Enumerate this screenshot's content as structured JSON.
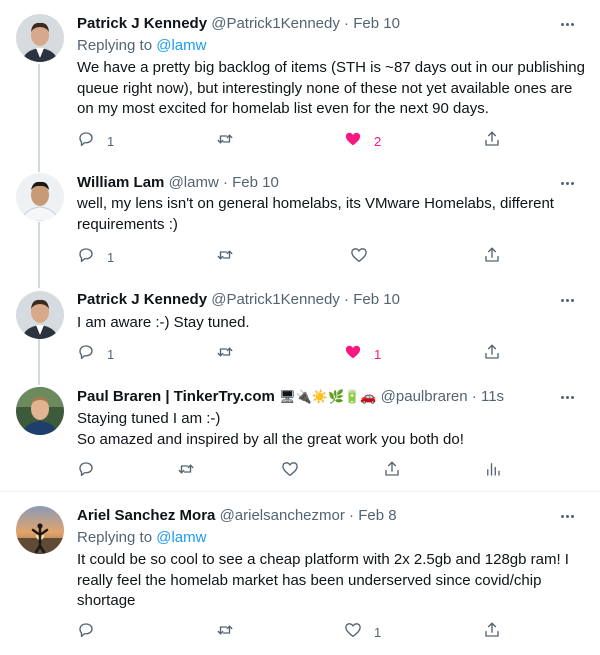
{
  "tweets": [
    {
      "name": "Patrick J Kennedy",
      "handle": "@Patrick1Kennedy",
      "dot": "·",
      "time": "Feb 10",
      "replying_prefix": "Replying to ",
      "replying_mention": "@lamw",
      "text": "We have a pretty big backlog of items (STH is ~87 days out in our publishing queue right now), but interestingly none of these not yet available ones are on my most excited for homelab list even for the next 90 days.",
      "reply_count": "1",
      "retweet_count": "",
      "like_count": "2",
      "liked": true
    },
    {
      "name": "William Lam",
      "handle": "@lamw",
      "dot": "·",
      "time": "Feb 10",
      "text": "well, my lens isn't on general homelabs, its VMware Homelabs, different requirements :)",
      "reply_count": "1",
      "retweet_count": "",
      "like_count": "",
      "liked": false
    },
    {
      "name": "Patrick J Kennedy",
      "handle": "@Patrick1Kennedy",
      "dot": "·",
      "time": "Feb 10",
      "text": "I am aware :-) Stay tuned.",
      "reply_count": "1",
      "retweet_count": "",
      "like_count": "1",
      "liked": true
    },
    {
      "name": "Paul Braren | TinkerTry.com",
      "name_emoji": "🖥🔌☀️🌿🔋🚗",
      "handle": "@paulbraren",
      "dot": "·",
      "time": "11s",
      "text_line1": "Staying tuned I am :-)",
      "text_line2": "So amazed and inspired by all the great work you both do!",
      "reply_count": "",
      "retweet_count": "",
      "like_count": "",
      "liked": false
    },
    {
      "name": "Ariel Sanchez Mora",
      "handle": "@arielsanchezmor",
      "dot": "·",
      "time": "Feb 8",
      "replying_prefix": "Replying to ",
      "replying_mention": "@lamw",
      "text": "It could be so cool to see a cheap platform with 2x 2.5gb and 128gb ram! I really feel the homelab market has been underserved since covid/chip shortage",
      "reply_count": "",
      "retweet_count": "",
      "like_count": "1",
      "liked": false
    }
  ],
  "colors": {
    "text": "#0f1419",
    "secondary": "#536471",
    "link": "#1d9bf0",
    "like": "#f91880",
    "thread_line": "#cfd9de",
    "separator": "#eff3f4"
  },
  "icons": [
    "reply-icon",
    "retweet-icon",
    "like-icon",
    "share-icon",
    "analytics-icon",
    "more-icon"
  ]
}
